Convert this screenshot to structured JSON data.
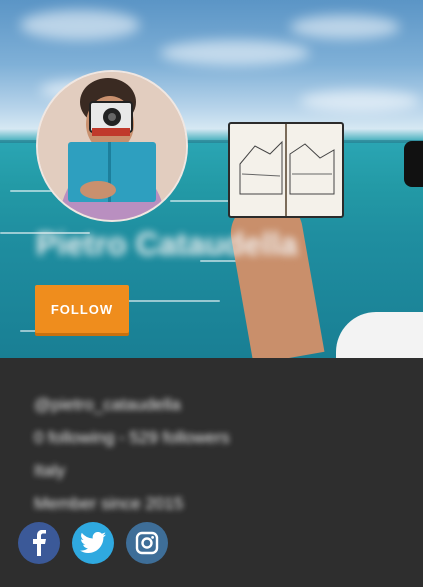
{
  "profile": {
    "name": "Pietro Cataudella",
    "follow_label": "FOLLOW",
    "handle": "@pietro_cataudella",
    "stats": "0 following - 529 followers",
    "location": "Italy",
    "member_since": "Member since 2015"
  },
  "social": [
    {
      "name": "facebook-icon",
      "color": "#3b5998"
    },
    {
      "name": "twitter-icon",
      "color": "#2fa9e0"
    },
    {
      "name": "instagram-icon",
      "color": "#3e6e98"
    }
  ],
  "colors": {
    "accent": "#ef8d1d",
    "panel": "#2e2e2e"
  }
}
